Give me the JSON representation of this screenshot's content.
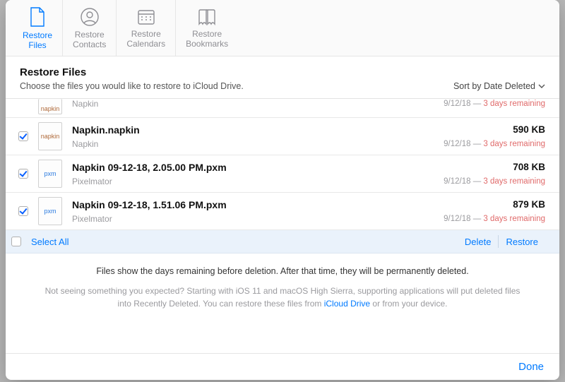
{
  "tabs": [
    {
      "label_a": "Restore",
      "label_b": "Files"
    },
    {
      "label_a": "Restore",
      "label_b": "Contacts"
    },
    {
      "label_a": "Restore",
      "label_b": "Calendars"
    },
    {
      "label_a": "Restore",
      "label_b": "Bookmarks"
    }
  ],
  "headline": "Restore Files",
  "subtitle": "Choose the files you would like to restore to iCloud Drive.",
  "sort_label": "Sort by Date Deleted",
  "files_partial": {
    "source": "Napkin",
    "date": "9/12/18",
    "sep": " — ",
    "remaining": "3 days remaining"
  },
  "files": [
    {
      "name": "Napkin.napkin",
      "source": "Napkin",
      "size": "590 KB",
      "date": "9/12/18",
      "sep": " — ",
      "remaining": "3 days remaining",
      "ext_label": "napkin",
      "ext_class": "napkin",
      "checked": true
    },
    {
      "name": "Napkin 09-12-18, 2.05.00 PM.pxm",
      "source": "Pixelmator",
      "size": "708 KB",
      "date": "9/12/18",
      "sep": " — ",
      "remaining": "3 days remaining",
      "ext_label": "pxm",
      "ext_class": "pxm",
      "checked": true
    },
    {
      "name": "Napkin 09-12-18, 1.51.06 PM.pxm",
      "source": "Pixelmator",
      "size": "879 KB",
      "date": "9/12/18",
      "sep": " — ",
      "remaining": "3 days remaining",
      "ext_label": "pxm",
      "ext_class": "pxm",
      "checked": true
    }
  ],
  "actions": {
    "select_all": "Select All",
    "delete": "Delete",
    "restore": "Restore"
  },
  "note_primary": "Files show the days remaining before deletion. After that time, they will be permanently deleted.",
  "note_secondary_a": "Not seeing something you expected? Starting with iOS 11 and macOS High Sierra, supporting applications will put deleted files into Recently Deleted. You can restore these files from ",
  "note_secondary_link": "iCloud Drive",
  "note_secondary_b": " or from your device.",
  "done": "Done"
}
